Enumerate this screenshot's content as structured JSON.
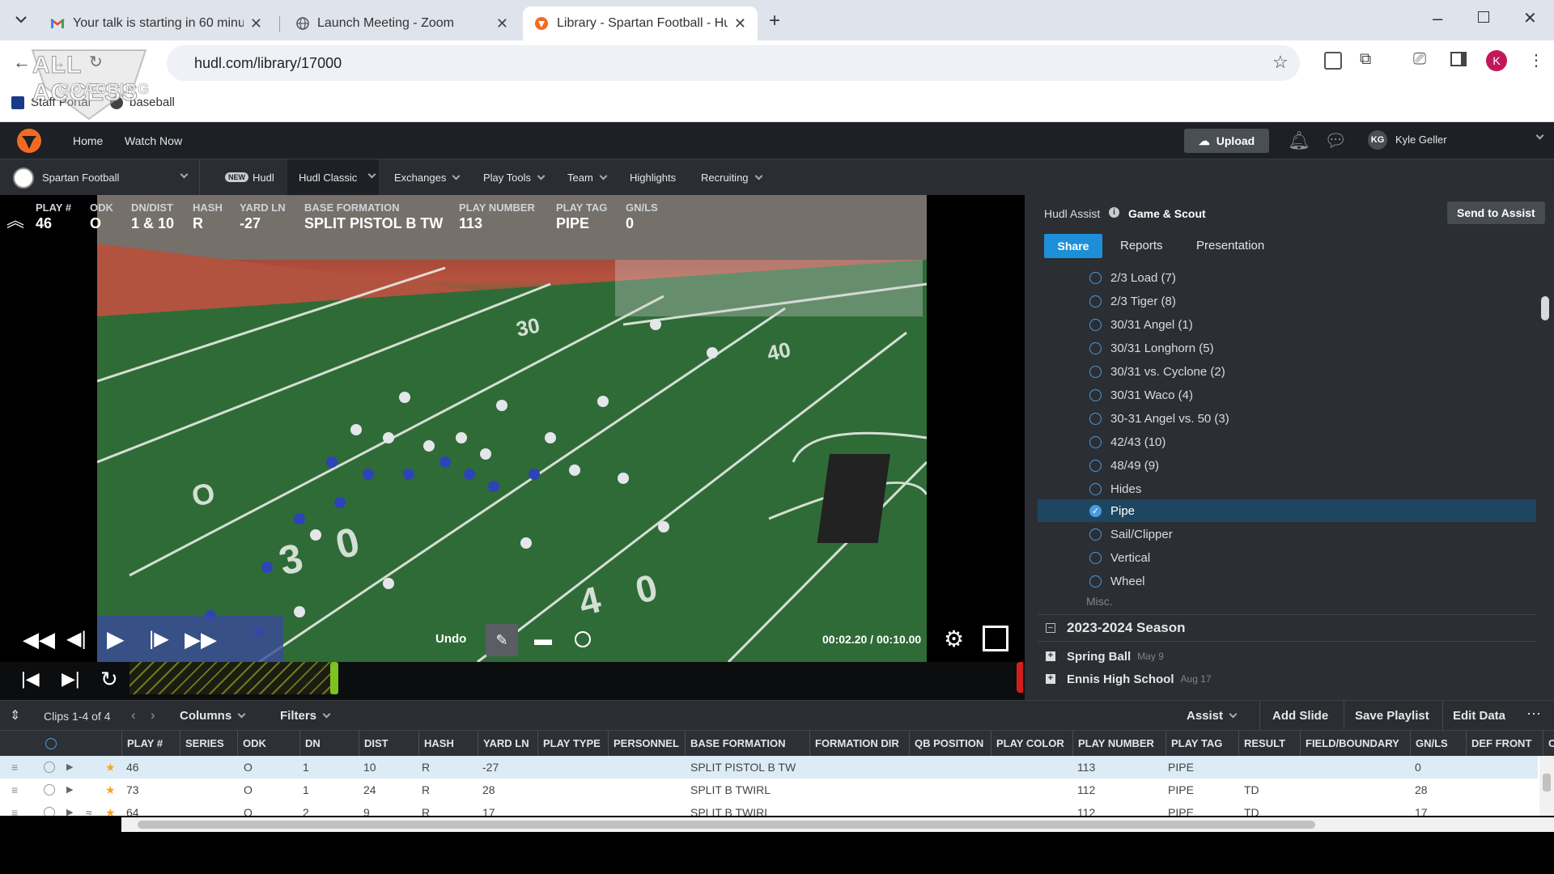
{
  "browser": {
    "tabs": [
      {
        "title": "Your talk is starting in 60 minut",
        "icon": "gmail-icon"
      },
      {
        "title": "Launch Meeting - Zoom",
        "icon": "globe-icon"
      },
      {
        "title": "Library - Spartan Football - Hud",
        "icon": "hudl-icon"
      }
    ],
    "url": "hudl.com/library/17000",
    "bookmarks": [
      {
        "label": "Staff Portal"
      },
      {
        "label": "baseball"
      }
    ],
    "profile_initial": "K"
  },
  "watermark": {
    "line1": "ALL ACCESS",
    "line2": "COACHING"
  },
  "topnav": {
    "home": "Home",
    "watch_now": "Watch Now",
    "upload": "Upload",
    "user_initials": "KG",
    "user_name": "Kyle Geller"
  },
  "subnav": {
    "team": "Spartan Football",
    "new_badge": "NEW",
    "hudl": "Hudl",
    "items": [
      "Hudl Classic",
      "Exchanges",
      "Play Tools",
      "Team",
      "Highlights",
      "Recruiting"
    ]
  },
  "hud": [
    {
      "label": "PLAY #",
      "value": "46"
    },
    {
      "label": "ODK",
      "value": "O"
    },
    {
      "label": "DN/DIST",
      "value": "1 & 10"
    },
    {
      "label": "HASH",
      "value": "R"
    },
    {
      "label": "YARD LN",
      "value": "-27"
    },
    {
      "label": "BASE FORMATION",
      "value": "SPLIT PISTOL B TW"
    },
    {
      "label": "PLAY NUMBER",
      "value": "113"
    },
    {
      "label": "PLAY TAG",
      "value": "PIPE"
    },
    {
      "label": "GN/LS",
      "value": "0"
    }
  ],
  "player": {
    "undo": "Undo",
    "time_current": "00:02.20",
    "time_separator": " / ",
    "time_total": "00:10.00"
  },
  "assist": {
    "title": "Hudl Assist",
    "subtitle": "Game & Scout",
    "send": "Send to Assist",
    "tabs": [
      "Share",
      "Reports",
      "Presentation"
    ],
    "tags": [
      {
        "label": "2/3 Load (7)",
        "selected": false
      },
      {
        "label": "2/3 Tiger (8)",
        "selected": false
      },
      {
        "label": "30/31 Angel (1)",
        "selected": false
      },
      {
        "label": "30/31 Longhorn (5)",
        "selected": false
      },
      {
        "label": "30/31 vs. Cyclone (2)",
        "selected": false
      },
      {
        "label": "30/31 Waco (4)",
        "selected": false
      },
      {
        "label": "30-31 Angel vs. 50 (3)",
        "selected": false
      },
      {
        "label": "42/43 (10)",
        "selected": false
      },
      {
        "label": "48/49 (9)",
        "selected": false
      },
      {
        "label": "Hides",
        "selected": false
      },
      {
        "label": "Pipe",
        "selected": true
      },
      {
        "label": "Sail/Clipper",
        "selected": false
      },
      {
        "label": "Vertical",
        "selected": false
      },
      {
        "label": "Wheel",
        "selected": false
      }
    ],
    "misc": "Misc.",
    "season": "2023-2024 Season",
    "folders": [
      {
        "name": "Spring Ball",
        "date": "May 9"
      },
      {
        "name": "Ennis High School",
        "date": "Aug 17"
      }
    ]
  },
  "table": {
    "clips": "Clips 1-4 of 4",
    "columns_btn": "Columns",
    "filters_btn": "Filters",
    "assist_btn": "Assist",
    "add_slide": "Add Slide",
    "save_playlist": "Save Playlist",
    "edit_data": "Edit Data",
    "headers": [
      "PLAY #",
      "SERIES",
      "ODK",
      "DN",
      "DIST",
      "HASH",
      "YARD LN",
      "PLAY TYPE",
      "PERSONNEL",
      "BASE FORMATION",
      "FORMATION DIR",
      "QB POSITION",
      "PLAY COLOR",
      "PLAY NUMBER",
      "PLAY TAG",
      "RESULT",
      "FIELD/BOUNDARY",
      "GN/LS",
      "DEF FRONT",
      "C"
    ],
    "rows": [
      [
        "46",
        "",
        "O",
        "1",
        "10",
        "R",
        "-27",
        "",
        "",
        "SPLIT PISTOL B TW",
        "",
        "",
        "",
        "113",
        "PIPE",
        "",
        "",
        "0",
        "",
        ""
      ],
      [
        "73",
        "",
        "O",
        "1",
        "24",
        "R",
        "28",
        "",
        "",
        "SPLIT B TWIRL",
        "",
        "",
        "",
        "112",
        "PIPE",
        "TD",
        "",
        "28",
        "",
        ""
      ],
      [
        "64",
        "",
        "O",
        "2",
        "9",
        "R",
        "17",
        "",
        "",
        "SPLIT B TWIRL",
        "",
        "",
        "",
        "112",
        "PIPE",
        "TD",
        "",
        "17",
        "",
        ""
      ]
    ]
  },
  "colors": {
    "hudl_orange": "#f26a21",
    "accent_blue": "#1d8fd8",
    "dark_bg": "#1d2024"
  }
}
